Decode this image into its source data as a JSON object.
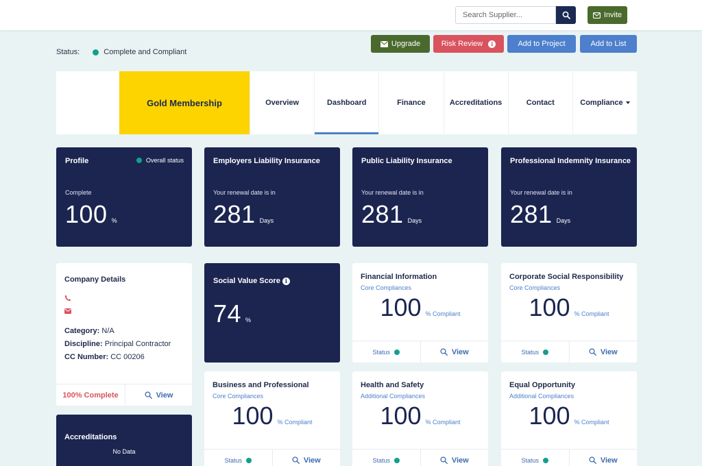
{
  "header": {
    "search_placeholder": "Search Supplier...",
    "invite_label": "Invite"
  },
  "status": {
    "label": "Status:",
    "value": "Complete and Compliant",
    "color": "#12a08c"
  },
  "actions": {
    "upgrade": "Upgrade",
    "risk_review": "Risk Review",
    "add_to_project": "Add to Project",
    "add_to_list": "Add to List"
  },
  "tabs": {
    "membership": "Gold Membership",
    "items": [
      "Overview",
      "Dashboard",
      "Finance",
      "Accreditations",
      "Contact",
      "Compliance"
    ],
    "active": "Dashboard"
  },
  "profile": {
    "title": "Profile",
    "overall_status": "Overall status",
    "sub": "Complete",
    "value": "100",
    "unit": "%"
  },
  "insurance": [
    {
      "title": "Employers Liability Insurance",
      "sub": "Your renewal date is in",
      "value": "281",
      "unit": "Days"
    },
    {
      "title": "Public Liability Insurance",
      "sub": "Your renewal date is in",
      "value": "281",
      "unit": "Days"
    },
    {
      "title": "Professional Indemnity Insurance",
      "sub": "Your renewal date is in",
      "value": "281",
      "unit": "Days"
    }
  ],
  "company": {
    "title": "Company Details",
    "category_label": "Category:",
    "category_value": "N/A",
    "discipline_label": "Discipline:",
    "discipline_value": "Principal Contractor",
    "cc_label": "CC Number:",
    "cc_value": "CC 00206",
    "complete": "100% Complete",
    "view": "View"
  },
  "social": {
    "title": "Social Value Score",
    "value": "74",
    "unit": "%"
  },
  "compliance_cards": [
    {
      "title": "Financial Information",
      "sub": "Core Compliances",
      "value": "100",
      "unit": "% Compliant",
      "status": "Status",
      "view": "View"
    },
    {
      "title": "Corporate Social Responsibility",
      "sub": "Core Compliances",
      "value": "100",
      "unit": "% Compliant",
      "status": "Status",
      "view": "View"
    },
    {
      "title": "Business and Professional",
      "sub": "Core Compliances",
      "value": "100",
      "unit": "% Compliant",
      "status": "Status",
      "view": "View"
    },
    {
      "title": "Health and Safety",
      "sub": "Additional Compliances",
      "value": "100",
      "unit": "% Compliant",
      "status": "Status",
      "view": "View"
    },
    {
      "title": "Equal Opportunity",
      "sub": "Additional Compliances",
      "value": "100",
      "unit": "% Compliant",
      "status": "Status",
      "view": "View"
    }
  ],
  "accreditations": {
    "title": "Accreditations",
    "empty": "No Data"
  },
  "colors": {
    "navy": "#1b2550",
    "gold": "#fdd300",
    "green_button": "#4a6a2d",
    "red_button": "#d9535e",
    "blue_button": "#4d7fcc",
    "teal_status": "#12a08c"
  },
  "icons": {
    "search": "search-icon",
    "invite": "envelope-icon",
    "upgrade": "envelope-icon",
    "risk": "info-icon",
    "phone": "phone-icon",
    "email": "envelope-icon",
    "view": "magnifier-icon"
  }
}
